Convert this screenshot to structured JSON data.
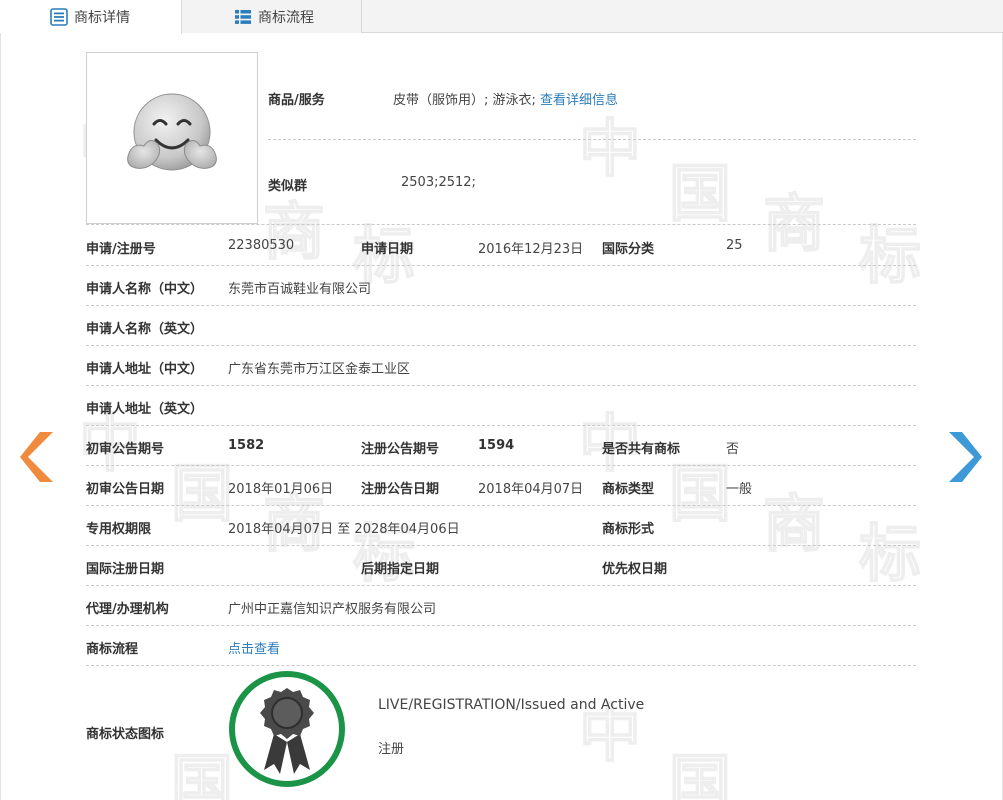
{
  "tabs": [
    {
      "label": "商标详情",
      "active": true,
      "icon": "list-detail-icon"
    },
    {
      "label": "商标流程",
      "active": false,
      "icon": "grid-list-icon"
    }
  ],
  "colors": {
    "accent_blue": "#2b7dbb",
    "prev_arrow": "#f08a3c",
    "next_arrow": "#3d9ad6",
    "status_green": "#1b9448"
  },
  "top": {
    "goods_label": "商品/服务",
    "goods_value": "皮带（服饰用）; 游泳衣;",
    "goods_link": "查看详细信息",
    "group_label": "类似群",
    "group_value": "2503;2512;"
  },
  "rows": {
    "app_no_label": "申请/注册号",
    "app_no": "22380530",
    "app_date_label": "申请日期",
    "app_date": "2016年12月23日",
    "intl_class_label": "国际分类",
    "intl_class": "25",
    "applicant_cn_label": "申请人名称（中文）",
    "applicant_cn": "东莞市百诚鞋业有限公司",
    "applicant_en_label": "申请人名称（英文）",
    "address_cn_label": "申请人地址（中文）",
    "address_cn": "广东省东莞市万江区金泰工业区",
    "address_en_label": "申请人地址（英文）",
    "prelim_issue_label": "初审公告期号",
    "prelim_issue": "1582",
    "reg_issue_label": "注册公告期号",
    "reg_issue": "1594",
    "shared_label": "是否共有商标",
    "shared": "否",
    "prelim_date_label": "初审公告日期",
    "prelim_date": "2018年01月06日",
    "reg_date_label": "注册公告日期",
    "reg_date": "2018年04月07日",
    "mark_type_label": "商标类型",
    "mark_type": "一般",
    "term_label": "专用权期限",
    "term": "2018年04月07日 至 2028年04月06日",
    "mark_form_label": "商标形式",
    "intl_reg_date_label": "国际注册日期",
    "later_date_label": "后期指定日期",
    "priority_date_label": "优先权日期",
    "agent_label": "代理/办理机构",
    "agent": "广州中正嘉信知识产权服务有限公司",
    "flow_label": "商标流程",
    "flow_link": "点击查看",
    "status_label": "商标状态图标",
    "status_en": "LIVE/REGISTRATION/Issued and Active",
    "status_cn": "注册"
  }
}
